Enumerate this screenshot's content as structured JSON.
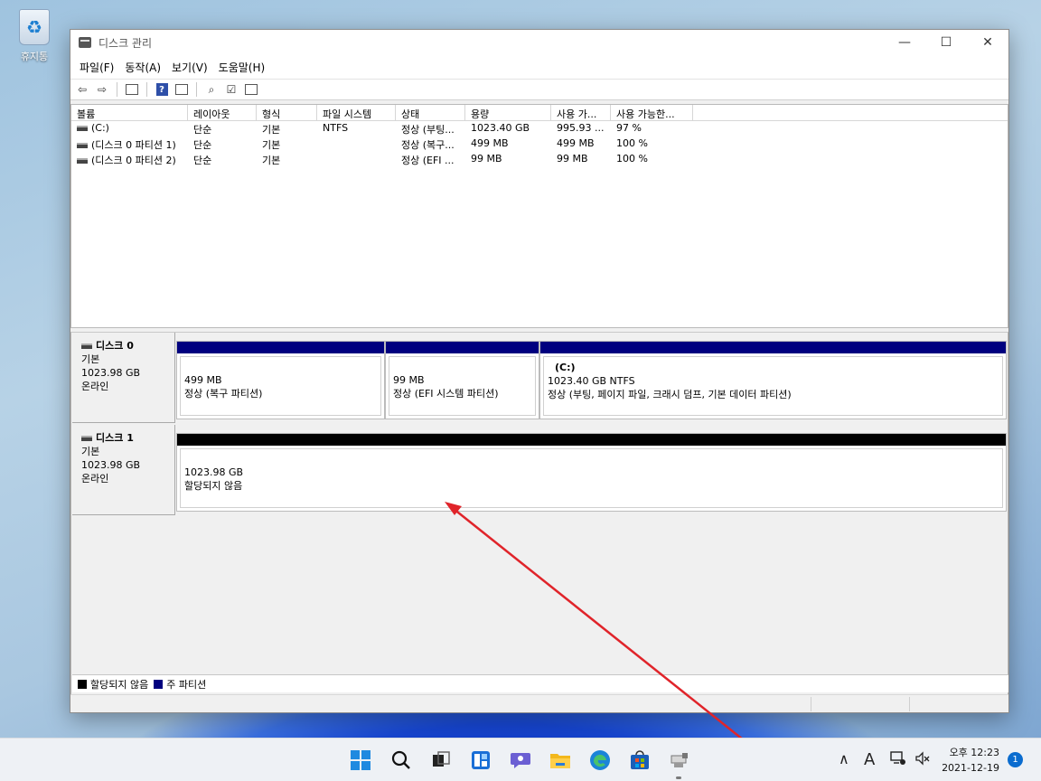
{
  "desktop": {
    "recycle_bin_label": "휴지통"
  },
  "window": {
    "title": "디스크 관리",
    "menu": [
      "파일(F)",
      "동작(A)",
      "보기(V)",
      "도움말(H)"
    ]
  },
  "volume_list": {
    "columns": [
      "볼륨",
      "레이아웃",
      "형식",
      "파일 시스템",
      "상태",
      "용량",
      "사용 가...",
      "사용 가능한..."
    ],
    "rows": [
      [
        "(C:)",
        "단순",
        "기본",
        "NTFS",
        "정상 (부팅...",
        "1023.40 GB",
        "995.93 ...",
        "97 %"
      ],
      [
        "(디스크 0 파티션 1)",
        "단순",
        "기본",
        "",
        "정상 (복구...",
        "499 MB",
        "499 MB",
        "100 %"
      ],
      [
        "(디스크 0 파티션 2)",
        "단순",
        "기본",
        "",
        "정상 (EFI ...",
        "99 MB",
        "99 MB",
        "100 %"
      ]
    ]
  },
  "disks": [
    {
      "name": "디스크 0",
      "type": "기본",
      "size": "1023.98 GB",
      "status": "온라인",
      "partitions": [
        {
          "label": "",
          "size": "499 MB",
          "desc": "정상 (복구 파티션)",
          "kind": "primary"
        },
        {
          "label": "",
          "size": "99 MB",
          "desc": "정상 (EFI 시스템 파티션)",
          "kind": "primary"
        },
        {
          "label": "(C:)",
          "size": "1023.40 GB NTFS",
          "desc": "정상 (부팅, 페이지 파일, 크래시 덤프, 기본 데이터 파티션)",
          "kind": "primary"
        }
      ]
    },
    {
      "name": "디스크 1",
      "type": "기본",
      "size": "1023.98 GB",
      "status": "온라인",
      "partitions": [
        {
          "label": "",
          "size": "1023.98 GB",
          "desc": "할당되지 않음",
          "kind": "unallocated"
        }
      ]
    }
  ],
  "legend": {
    "unallocated": "할당되지 않음",
    "primary": "주 파티션"
  },
  "colors": {
    "primary_band": "#00007f",
    "unallocated_band": "#000000",
    "annotation_arrow": "#e0242a",
    "accent": "#0a6ccf"
  },
  "taskbar": {
    "icons": [
      "windows-start-icon",
      "search-icon",
      "task-view-icon",
      "widgets-icon",
      "chat-icon",
      "file-explorer-icon",
      "edge-icon",
      "store-icon",
      "disk-management-icon"
    ],
    "tray": {
      "ime": "A",
      "time_period": "오후 12:23",
      "date": "2021-12-19",
      "notification_count": "1"
    }
  }
}
